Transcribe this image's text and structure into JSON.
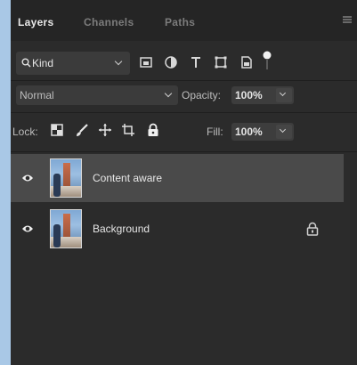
{
  "tabs": [
    {
      "label": "Layers",
      "active": true
    },
    {
      "label": "Channels",
      "active": false
    },
    {
      "label": "Paths",
      "active": false
    }
  ],
  "filter": {
    "kind_label": "Kind",
    "icons": [
      "search-icon",
      "pixel-filter-icon",
      "adjustment-filter-icon",
      "type-filter-icon",
      "shape-filter-icon",
      "smart-object-filter-icon",
      "filter-toggle-icon"
    ]
  },
  "blend": {
    "mode": "Normal",
    "opacity_label": "Opacity:",
    "opacity_value": "100%"
  },
  "lock": {
    "label": "Lock:",
    "icons": [
      "lock-transparent-icon",
      "lock-image-icon",
      "lock-position-icon",
      "lock-artboard-icon",
      "lock-all-icon"
    ],
    "fill_label": "Fill:",
    "fill_value": "100%"
  },
  "layers": [
    {
      "name": "Content aware",
      "visible": true,
      "selected": true,
      "locked": false
    },
    {
      "name": "Background",
      "visible": true,
      "selected": false,
      "locked": true
    }
  ],
  "colors": {
    "panel_bg": "#2b2b2b",
    "tab_bg": "#252525",
    "selected_layer": "#4a4a4a",
    "frame_bg": "#a9c8e6"
  }
}
